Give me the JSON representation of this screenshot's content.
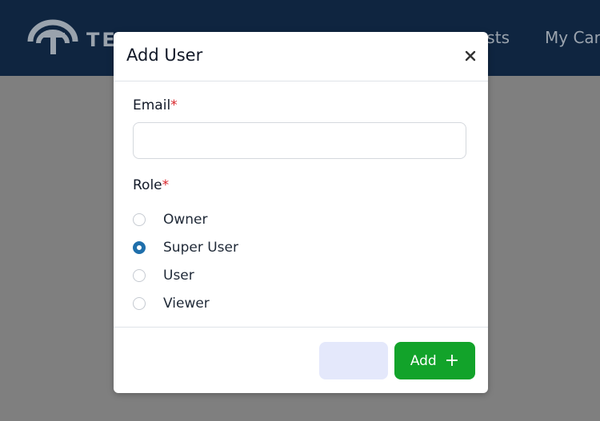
{
  "app": {
    "brand_text": "TESTBASE",
    "nav": [
      {
        "label": "ests"
      },
      {
        "label": "My Car"
      }
    ]
  },
  "modal": {
    "title": "Add User",
    "close_icon": "close-icon",
    "email": {
      "label": "Email",
      "required_mark": "*",
      "value": "",
      "placeholder": ""
    },
    "role": {
      "label": "Role",
      "required_mark": "*",
      "options": [
        {
          "label": "Owner",
          "checked": false
        },
        {
          "label": "Super User",
          "checked": true
        },
        {
          "label": "User",
          "checked": false
        },
        {
          "label": "Viewer",
          "checked": false
        }
      ]
    },
    "footer": {
      "secondary_label": "",
      "add_label": "Add",
      "add_icon": "+"
    }
  },
  "colors": {
    "header_bg": "#0f2540",
    "overlay": "#808080",
    "radio_checked": "#1f6fab",
    "add_button": "#12a32a",
    "secondary_button": "#e4e8fb",
    "required": "#d9252b"
  }
}
